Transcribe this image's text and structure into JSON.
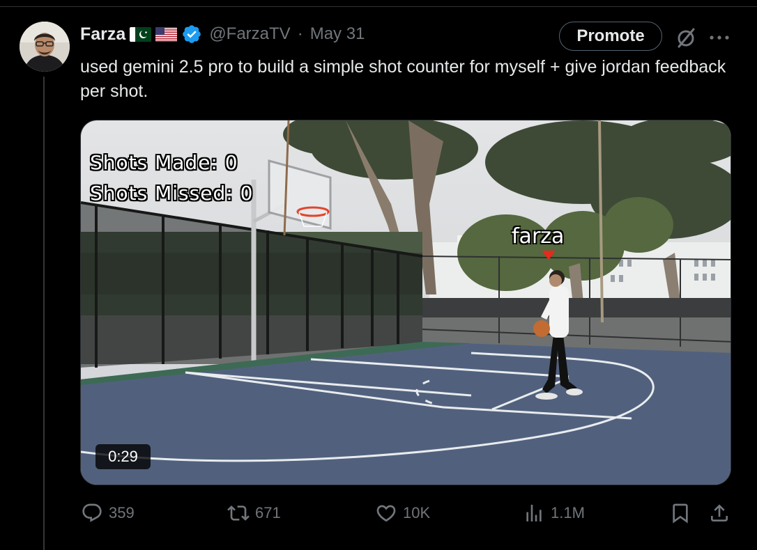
{
  "tweet": {
    "author_name": "Farza",
    "flags": [
      "pakistan-flag",
      "us-flag"
    ],
    "verified": true,
    "handle": "@FarzaTV",
    "separator": "·",
    "date": "May 31",
    "promote_label": "Promote",
    "text": "used gemini 2.5 pro to build a simple shot counter for myself + give jordan feedback per shot."
  },
  "video": {
    "overlay_made": "Shots Made: 0",
    "overlay_missed": "Shots Missed: 0",
    "player_label": "farza",
    "duration": "0:29"
  },
  "actions": {
    "replies": "359",
    "reposts": "671",
    "likes": "10K",
    "views": "1.1M"
  },
  "icons": [
    "verified-badge-icon",
    "grok-icon",
    "more-icon",
    "reply-icon",
    "repost-icon",
    "like-icon",
    "views-icon",
    "bookmark-icon",
    "share-icon"
  ],
  "colors": {
    "background": "#000000",
    "text_primary": "#e7e9ea",
    "text_secondary": "#71767b",
    "verified_blue": "#1d9bf0",
    "court": "#51617d"
  }
}
